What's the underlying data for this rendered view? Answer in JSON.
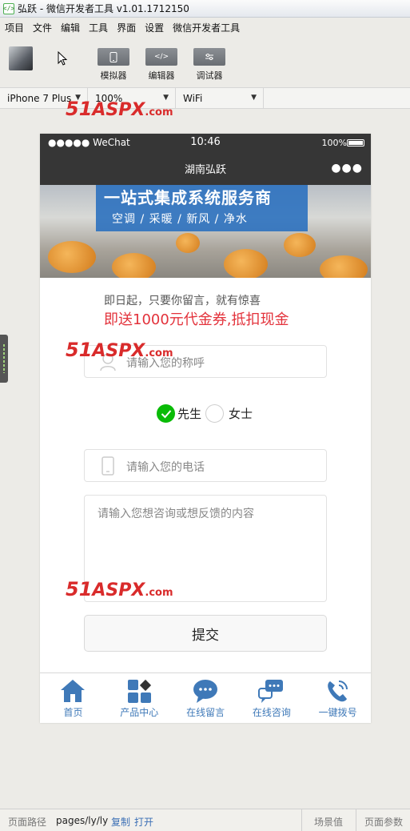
{
  "window": {
    "title": "弘跃 - 微信开发者工具 v1.01.1712150"
  },
  "menu": {
    "items": [
      "项目",
      "文件",
      "编辑",
      "工具",
      "界面",
      "设置",
      "微信开发者工具"
    ]
  },
  "toolbar": {
    "simulator": "模拟器",
    "editor": "编辑器",
    "debugger": "调试器"
  },
  "device": {
    "model": "iPhone 7 Plus",
    "zoom": "100%",
    "network": "WiFi"
  },
  "phone": {
    "status": {
      "carrier": "●●●●● WeChat",
      "time": "10:46",
      "battery": "100%"
    },
    "nav_title": "湖南弘跃",
    "nav_more": "●●●",
    "banner": {
      "headline": "一站式集成系统服务商",
      "services": "空调  /  采暖  /  新风  /  净水"
    },
    "promo_line1": "即日起，只要你留言，就有惊喜",
    "promo_line2": "即送1000元代金券,抵扣现金",
    "name_placeholder": "请输入您的称呼",
    "gender_male": "先生",
    "gender_female": "女士",
    "gender_selected": "male",
    "phone_placeholder": "请输入您的电话",
    "message_placeholder": "请输入您想咨询或想反馈的内容",
    "submit_label": "提交",
    "tabs": [
      {
        "label": "首页",
        "icon": "home-icon"
      },
      {
        "label": "产品中心",
        "icon": "grid-icon"
      },
      {
        "label": "在线留言",
        "icon": "chat-bubble-icon"
      },
      {
        "label": "在线咨询",
        "icon": "consult-icon"
      },
      {
        "label": "一键拨号",
        "icon": "phone-call-icon"
      }
    ]
  },
  "watermark": {
    "num": "51",
    "brand": "ASPX",
    "tld": ".com"
  },
  "bottom": {
    "path_label": "页面路径",
    "path_value": "pages/ly/ly",
    "copy": "复制",
    "open": "打开",
    "scene": "场景值",
    "params": "页面参数"
  },
  "colors": {
    "accent_blue": "#3f79b8",
    "check_green": "#09bb07",
    "promo_red": "#e3323b",
    "nav_dark": "#363636"
  }
}
